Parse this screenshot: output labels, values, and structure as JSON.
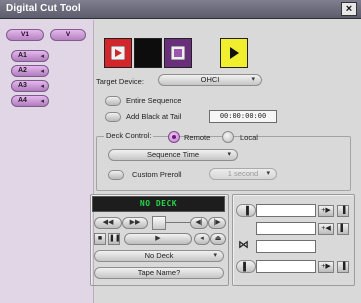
{
  "window": {
    "title": "Digital Cut Tool",
    "close_glyph": "×"
  },
  "tracks": {
    "video": [
      "V1",
      "V"
    ],
    "audio": [
      "A1",
      "A2",
      "A3",
      "A4"
    ],
    "arrow": "◂"
  },
  "source_buttons": [
    {
      "name": "play-red",
      "bg": "#d3262b",
      "icon": "play-icon"
    },
    {
      "name": "black",
      "bg": "#0d0d0d",
      "icon": "none"
    },
    {
      "name": "purple-stop",
      "bg": "#6a2f7b",
      "icon": "stop-icon"
    },
    {
      "name": "play-yellow",
      "bg": "#f1ef2d",
      "icon": "play-icon"
    }
  ],
  "target_device": {
    "label": "Target Device:",
    "value": "OHCI",
    "caret": "▾"
  },
  "options": {
    "entire_sequence": "Entire Sequence",
    "add_black_at_tail": "Add Black at Tail",
    "timecode": "00:00:00:00"
  },
  "deck_control": {
    "label": "Deck Control:",
    "remote": "Remote",
    "local": "Local",
    "mode": "Sequence Time",
    "custom_preroll": "Custom Preroll",
    "preroll_value": "1 second"
  },
  "deck": {
    "display": "NO DECK",
    "deck_select": "No Deck",
    "tape_name": "Tape Name?"
  },
  "transport_glyphs": {
    "rewind": "◀◀",
    "ffwd": "▶▶",
    "stop": "■",
    "pause": "❚❚",
    "play": "▶",
    "step_back": "◀|",
    "step_fwd": "|▶",
    "eject": "⏏",
    "left_arrow": "◂",
    "right_arrow": "▸",
    "in_mark": "▐",
    "out_mark": "▌",
    "goto_in": "+▶",
    "goto_out": "+◀",
    "bowtie": "⋈",
    "caret": "▾"
  },
  "colors": {
    "track_panel": "#e1d6e6",
    "track_button": "#c895d2",
    "deck_display_text": "#26d44a",
    "title_bar": "#6e6e7e"
  }
}
